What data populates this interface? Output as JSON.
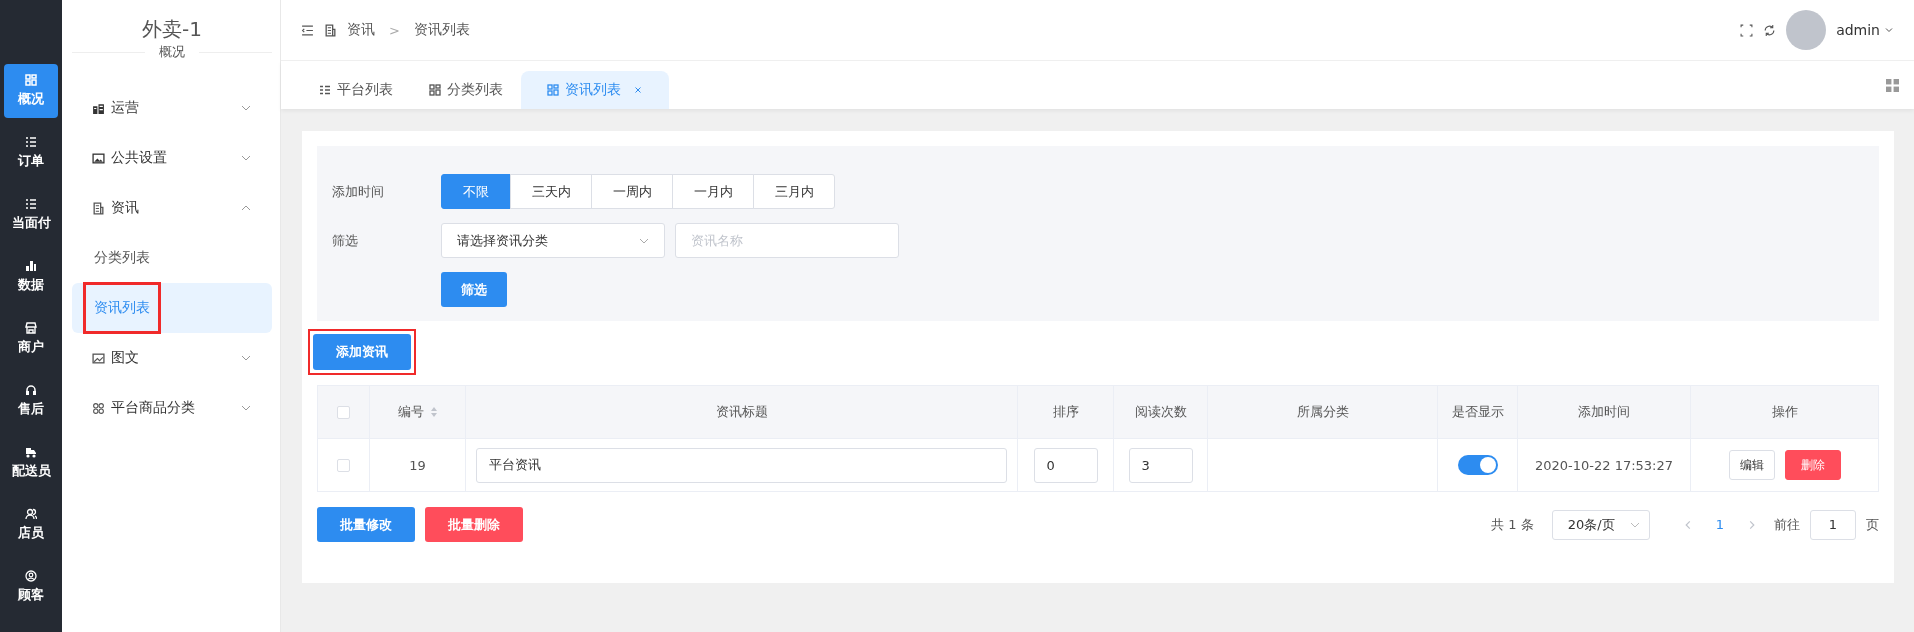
{
  "nav_rail": [
    {
      "label": "概况",
      "selected": true
    },
    {
      "label": "订单",
      "selected": false
    },
    {
      "label": "当面付",
      "selected": false
    },
    {
      "label": "数据",
      "selected": false
    },
    {
      "label": "商户",
      "selected": false
    },
    {
      "label": "售后",
      "selected": false
    },
    {
      "label": "配送员",
      "selected": false
    },
    {
      "label": "店员",
      "selected": false
    },
    {
      "label": "顾客",
      "selected": false
    }
  ],
  "sidebar": {
    "title": "外卖-1",
    "subtitle": "概况",
    "items": [
      {
        "label": "运营",
        "expanded": false
      },
      {
        "label": "公共设置",
        "expanded": false
      },
      {
        "label": "资讯",
        "expanded": true,
        "children": [
          {
            "label": "分类列表",
            "selected": false,
            "highlighted": false
          },
          {
            "label": "资讯列表",
            "selected": true,
            "highlighted": true
          }
        ]
      },
      {
        "label": "图文",
        "expanded": false
      },
      {
        "label": "平台商品分类",
        "expanded": false
      }
    ]
  },
  "header": {
    "breadcrumb": [
      "资讯",
      "资讯列表"
    ],
    "breadcrumb_separator": ">",
    "user": "admin"
  },
  "tabs": [
    {
      "label": "平台列表",
      "selected": false,
      "closable": false
    },
    {
      "label": "分类列表",
      "selected": false,
      "closable": false
    },
    {
      "label": "资讯列表",
      "selected": true,
      "closable": true
    }
  ],
  "filter": {
    "time_label": "添加时间",
    "time_options": [
      {
        "label": "不限",
        "selected": true
      },
      {
        "label": "三天内",
        "selected": false
      },
      {
        "label": "一周内",
        "selected": false
      },
      {
        "label": "一月内",
        "selected": false
      },
      {
        "label": "三月内",
        "selected": false
      }
    ],
    "filter_label": "筛选",
    "category_select": "请选择资讯分类",
    "name_field": {
      "placeholder": "资讯名称"
    },
    "submit": "筛选"
  },
  "add_button": {
    "label": "添加资讯",
    "highlighted": true
  },
  "table": {
    "select_all_checked": false,
    "columns": [
      "编号",
      "资讯标题",
      "排序",
      "阅读次数",
      "所属分类",
      "是否显示",
      "添加时间",
      "操作"
    ],
    "rows": [
      {
        "checked": false,
        "id": "19",
        "title": "平台资讯",
        "sort": "0",
        "reads": "3",
        "shown": true,
        "time": "2020-10-22 17:53:27",
        "actions": [
          "编辑",
          "删除"
        ]
      }
    ]
  },
  "bulk_actions": [
    "批量修改",
    "批量删除"
  ],
  "pagination": {
    "total": "共 1 条",
    "page_size": "20条/页",
    "pages": [
      {
        "label": "1",
        "selected": true
      }
    ],
    "goto_label": "前往",
    "goto_value": "1",
    "goto_suffix": "页"
  }
}
